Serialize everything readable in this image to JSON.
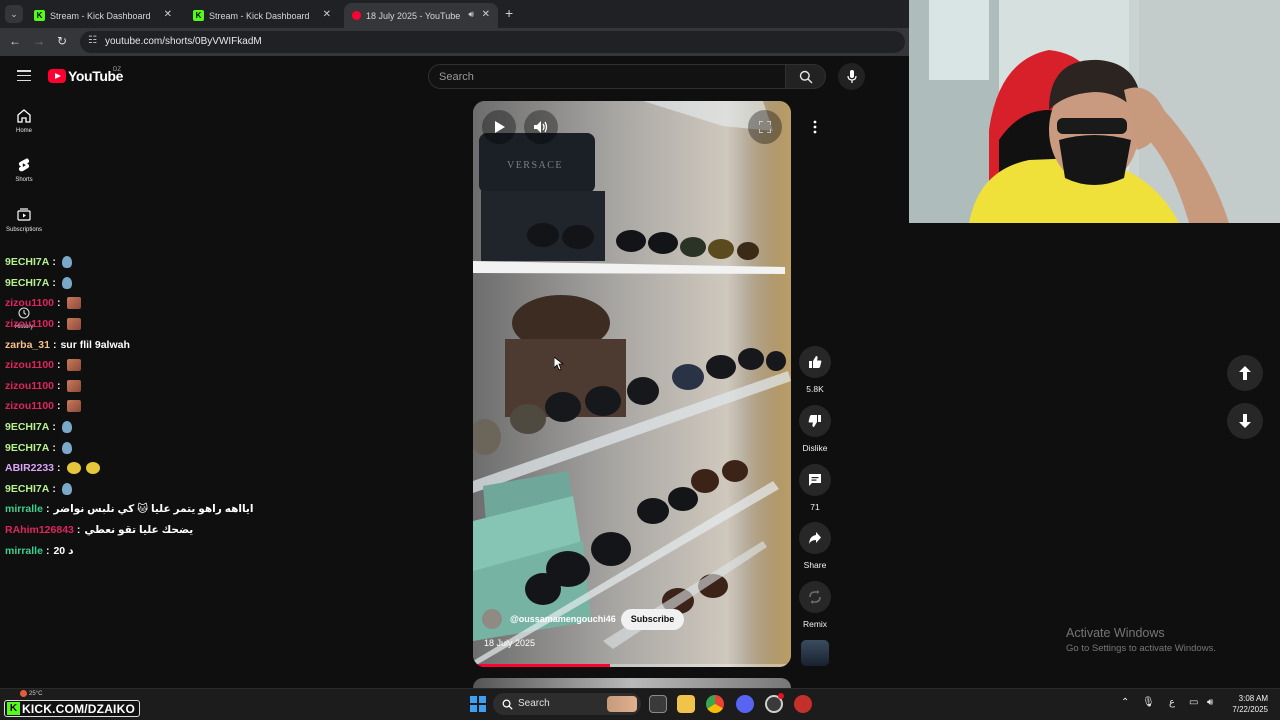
{
  "browser": {
    "tabs": [
      {
        "title": "Stream - Kick Dashboard",
        "icon": "kick-icon",
        "active": false
      },
      {
        "title": "Stream - Kick Dashboard",
        "icon": "kick-icon",
        "active": false
      },
      {
        "title": "18 July 2025 - YouTube",
        "icon": "youtube-icon",
        "active": true
      }
    ],
    "url": "youtube.com/shorts/0ByVWIFkadM"
  },
  "youtube": {
    "logo_text": "YouTube",
    "country_code": "DZ",
    "search_placeholder": "Search",
    "guide": [
      {
        "label": "Home",
        "icon": "home-icon"
      },
      {
        "label": "Shorts",
        "icon": "shorts-icon"
      },
      {
        "label": "Subscriptions",
        "icon": "subscriptions-icon"
      },
      {
        "label": "History",
        "icon": "history-icon"
      }
    ]
  },
  "short": {
    "channel": "@oussamamengouchi46",
    "subscribe_label": "Subscribe",
    "date": "18 July 2025",
    "progress": 0.43,
    "brand_text": "VERSACE",
    "actions": {
      "likes": "5.8K",
      "dislike": "Dislike",
      "comments": "71",
      "share": "Share",
      "remix": "Remix"
    }
  },
  "chat": [
    {
      "user": "9ECHI7A",
      "color": "#b8f28f",
      "msg": "",
      "emotes": [
        "drop"
      ]
    },
    {
      "user": "9ECHI7A",
      "color": "#b8f28f",
      "msg": "",
      "emotes": [
        "drop"
      ]
    },
    {
      "user": "zizou1100",
      "color": "#e0245e",
      "msg": "",
      "emotes": [
        "pic"
      ]
    },
    {
      "user": "zizou1100",
      "color": "#e0245e",
      "msg": "",
      "emotes": [
        "pic"
      ]
    },
    {
      "user": "zarba_31",
      "color": "#f6c08b",
      "msg": "sur flil 9alwah",
      "emotes": []
    },
    {
      "user": "zizou1100",
      "color": "#e0245e",
      "msg": "",
      "emotes": [
        "pic"
      ]
    },
    {
      "user": "zizou1100",
      "color": "#e0245e",
      "msg": "",
      "emotes": [
        "pic"
      ]
    },
    {
      "user": "zizou1100",
      "color": "#e0245e",
      "msg": "",
      "emotes": [
        "pic"
      ]
    },
    {
      "user": "9ECHI7A",
      "color": "#b8f28f",
      "msg": "",
      "emotes": [
        "drop"
      ]
    },
    {
      "user": "9ECHI7A",
      "color": "#b8f28f",
      "msg": "",
      "emotes": [
        "drop"
      ]
    },
    {
      "user": "ABIR2233",
      "color": "#d8a6f5",
      "msg": "",
      "emotes": [
        "ball",
        "ball"
      ]
    },
    {
      "user": "9ECHI7A",
      "color": "#b8f28f",
      "msg": "",
      "emotes": [
        "drop"
      ]
    },
    {
      "user": "mirralle",
      "color": "#3ecf8e",
      "msg": "ايااهه راهو يتمر عليا 🐱 كي نلبس نواضر",
      "emotes": []
    },
    {
      "user": "RAhim126843",
      "color": "#e0245e",
      "msg": "يضحك عليا تقو نعطي",
      "emotes": []
    },
    {
      "user": "mirralle",
      "color": "#3ecf8e",
      "msg": "20 د",
      "emotes": []
    }
  ],
  "overlay": {
    "kick_url": "KICK.COM/DZAIKO",
    "weather_temp": "25°C"
  },
  "windows": {
    "activate_title": "Activate Windows",
    "activate_sub": "Go to Settings to activate Windows.",
    "taskbar_search": "Search",
    "ime_label": "ع",
    "time": "3:08 AM",
    "date": "7/22/2025"
  },
  "colors": {
    "youtube_red": "#ff0033",
    "kick_green": "#53fc18"
  }
}
